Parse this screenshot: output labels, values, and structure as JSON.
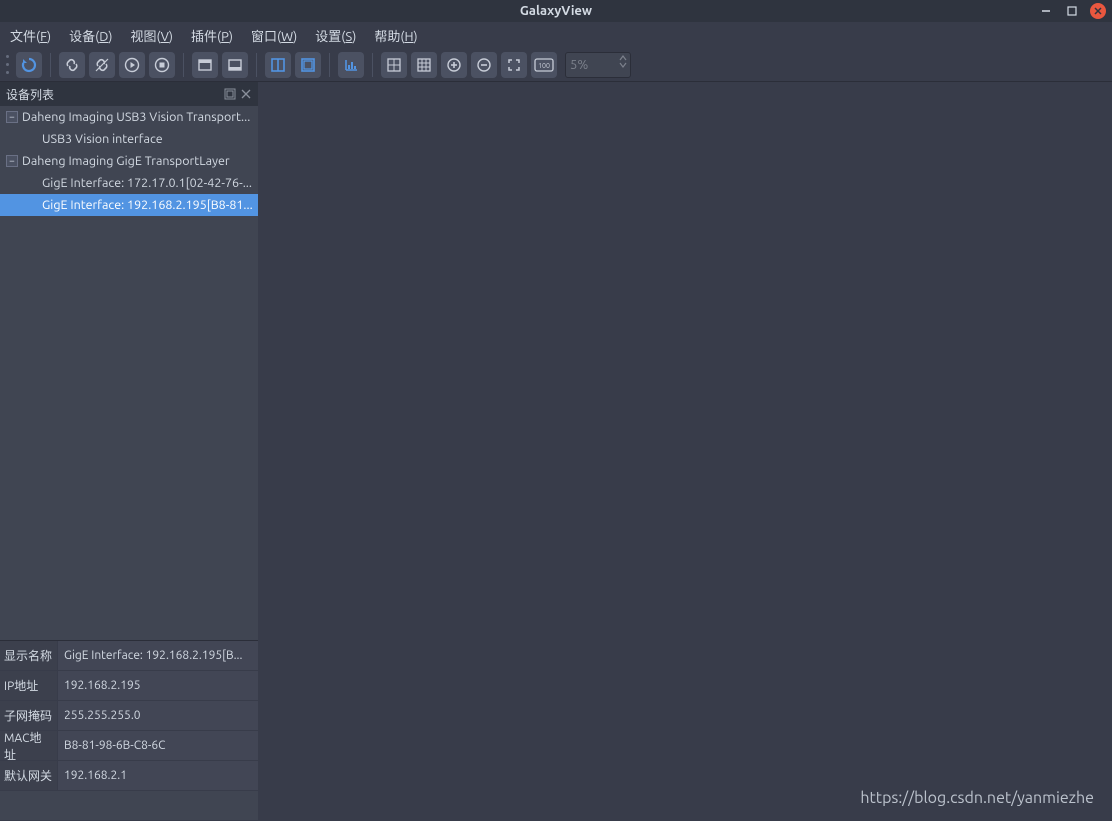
{
  "titlebar": {
    "title": "GalaxyView"
  },
  "menubar": {
    "items": [
      {
        "label": "文件",
        "accel": "F"
      },
      {
        "label": "设备",
        "accel": "D"
      },
      {
        "label": "视图",
        "accel": "V"
      },
      {
        "label": "插件",
        "accel": "P"
      },
      {
        "label": "窗口",
        "accel": "W"
      },
      {
        "label": "设置",
        "accel": "S"
      },
      {
        "label": "帮助",
        "accel": "H"
      }
    ]
  },
  "toolbar": {
    "zoom_value": "5%",
    "buttons": [
      "refresh",
      "link",
      "unlink",
      "play",
      "stop",
      "window-single",
      "window-bottom",
      "layout-split",
      "layout-full",
      "chart",
      "grid-4",
      "grid-9",
      "zoom-in",
      "zoom-out",
      "fit",
      "zoom-100"
    ]
  },
  "sidebar": {
    "title": "设备列表",
    "tree": [
      {
        "label": "Daheng Imaging USB3 Vision Transport...",
        "level": 0,
        "expander": "-"
      },
      {
        "label": "USB3 Vision interface",
        "level": 1
      },
      {
        "label": "Daheng Imaging GigE TransportLayer",
        "level": 0,
        "expander": "-"
      },
      {
        "label": "GigE Interface: 172.17.0.1[02-42-76-...",
        "level": 1
      },
      {
        "label": "GigE Interface: 192.168.2.195[B8-81...",
        "level": 1,
        "selected": true
      }
    ]
  },
  "properties": {
    "rows": [
      {
        "key": "显示名称",
        "value": "GigE Interface: 192.168.2.195[B..."
      },
      {
        "key": "IP地址",
        "value": "192.168.2.195"
      },
      {
        "key": "子网掩码",
        "value": "255.255.255.0"
      },
      {
        "key": "MAC地址",
        "value": "B8-81-98-6B-C8-6C"
      },
      {
        "key": "默认网关",
        "value": "192.168.2.1"
      }
    ]
  },
  "watermark": "https://blog.csdn.net/yanmiezhe"
}
